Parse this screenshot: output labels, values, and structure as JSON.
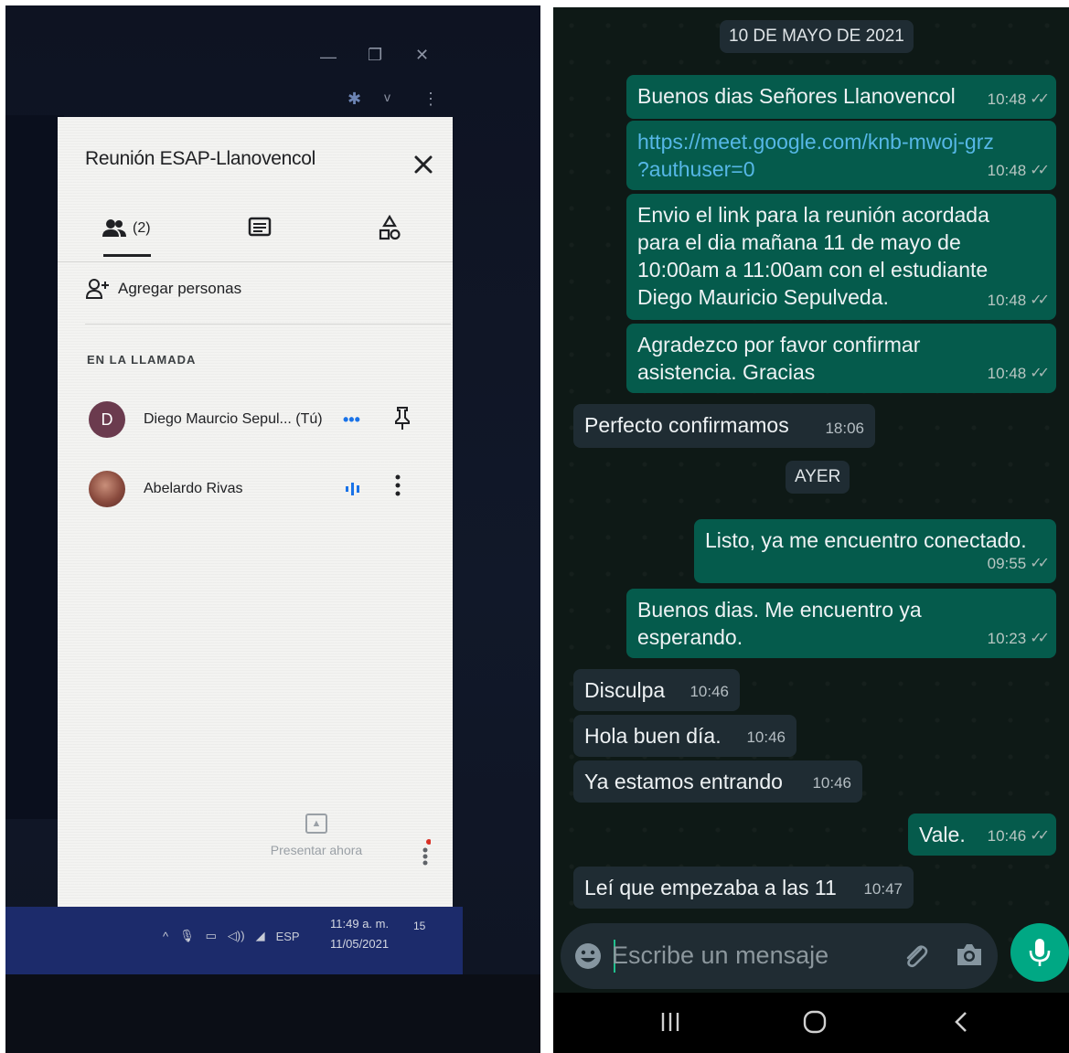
{
  "meet": {
    "title": "Reunión ESAP-Llanovencol",
    "people_count": "(2)",
    "add_people": "Agregar personas",
    "section_label": "EN LA LLAMADA",
    "participants": [
      {
        "initial": "D",
        "name": "Diego Maurcio Sepul... (Tú)",
        "extra": "•••"
      },
      {
        "initial": "",
        "name": "Abelardo Rivas",
        "extra": ""
      }
    ],
    "present_label": "Presentar ahora",
    "taskbar": {
      "lang": "ESP",
      "time": "11:49 a. m.",
      "date": "11/05/2021",
      "notif_count": "15"
    },
    "colors": {
      "panel": "#f3f3f1",
      "taskbar": "#1c2b6b",
      "accent": "#1a73e8"
    }
  },
  "whatsapp": {
    "date_labels": [
      "10 DE MAYO DE 2021",
      "AYER"
    ],
    "messages": [
      {
        "dir": "out",
        "text": "Buenos dias Señores Llanovencol",
        "time": "10:48"
      },
      {
        "dir": "out",
        "link": "https://meet.google.com/knb-mwoj-grz",
        "link2": "?authuser=0",
        "time": "10:48"
      },
      {
        "dir": "out",
        "lines": [
          "Envio el link para la reunión acordada",
          "para el dia mañana 11 de mayo de",
          "10:00am a 11:00am con el estudiante",
          "Diego Mauricio Sepulveda."
        ],
        "time": "10:48"
      },
      {
        "dir": "out",
        "lines": [
          "Agradezco por favor confirmar",
          "asistencia. Gracias"
        ],
        "time": "10:48"
      },
      {
        "dir": "in",
        "text": "Perfecto confirmamos",
        "time": "18:06"
      },
      {
        "dir": "out",
        "text": "Listo, ya me encuentro conectado.",
        "time": "09:55"
      },
      {
        "dir": "out",
        "lines": [
          "Buenos dias. Me encuentro ya",
          "esperando."
        ],
        "time": "10:23"
      },
      {
        "dir": "in",
        "text": "Disculpa",
        "time": "10:46"
      },
      {
        "dir": "in",
        "text": "Hola buen día.",
        "time": "10:46"
      },
      {
        "dir": "in",
        "text": "Ya estamos entrando",
        "time": "10:46"
      },
      {
        "dir": "out",
        "text": "Vale.",
        "time": "10:46"
      },
      {
        "dir": "in",
        "text": "Leí que empezaba a las 11",
        "time": "10:47"
      }
    ],
    "composer_placeholder": "Escribe un mensaje",
    "colors": {
      "outgoing": "#055b4c",
      "incoming": "#1f2c33",
      "mic": "#00a884",
      "link": "#56b7e6"
    }
  }
}
